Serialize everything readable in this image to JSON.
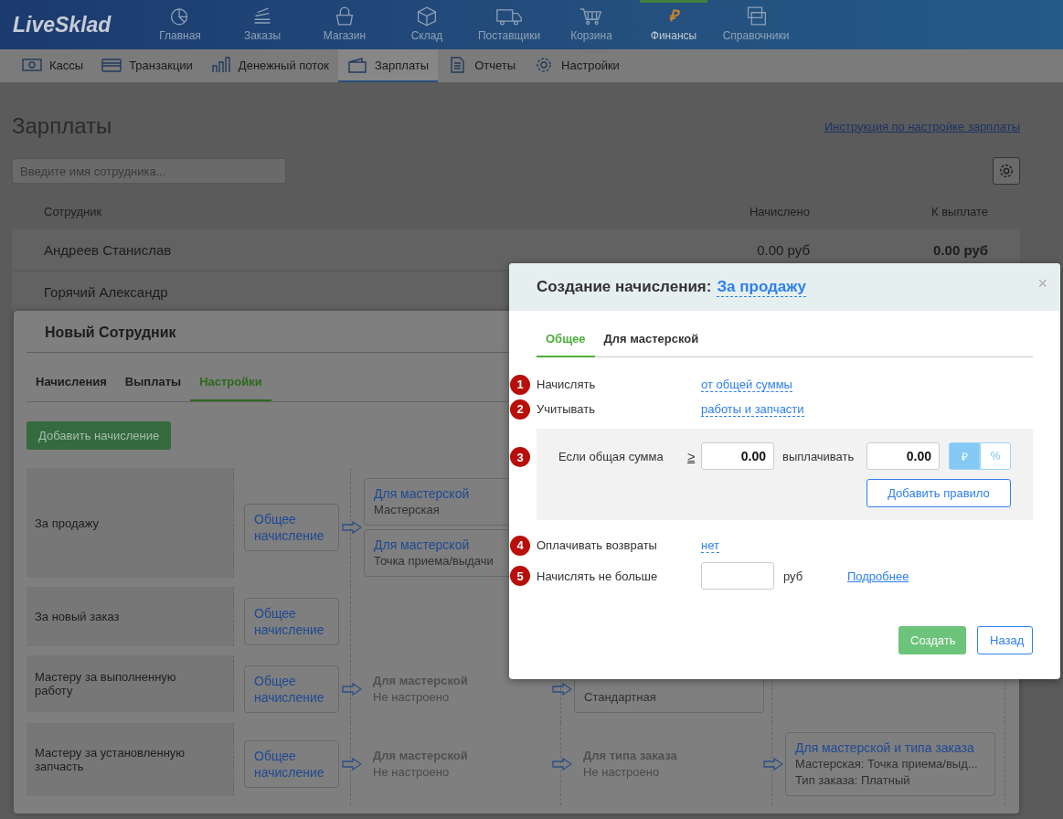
{
  "top_nav": {
    "logo": "LiveSklad",
    "items": [
      {
        "label": "Главная",
        "selected": false
      },
      {
        "label": "Заказы",
        "selected": false
      },
      {
        "label": "Магазин",
        "selected": false
      },
      {
        "label": "Склад",
        "selected": false
      },
      {
        "label": "Поставщики",
        "selected": false
      },
      {
        "label": "Корзина",
        "selected": false
      },
      {
        "label": "Финансы",
        "glyph": "₽",
        "selected": true
      },
      {
        "label": "Справочники",
        "selected": false
      }
    ]
  },
  "sub_nav": {
    "items": [
      {
        "label": "Кассы",
        "selected": false
      },
      {
        "label": "Транзакции",
        "selected": false
      },
      {
        "label": "Денежный поток",
        "selected": false
      },
      {
        "label": "Зарплаты",
        "selected": true
      },
      {
        "label": "Отчеты",
        "selected": false
      },
      {
        "label": "Настройки",
        "selected": false
      }
    ]
  },
  "page": {
    "title": "Зарплаты",
    "help_link": "Инструкция по настройке зарплаты",
    "search": {
      "placeholder": "Введите имя сотрудника..."
    },
    "table": {
      "columns": [
        "Сотрудник",
        "Начислено",
        "К выплате"
      ],
      "rows": [
        {
          "name": "Андреев Станислав",
          "accrued": "0.00 руб",
          "payable": "0.00 руб"
        },
        {
          "name": "Горячий Александр"
        }
      ]
    }
  },
  "employee_panel": {
    "title": "Новый Сотрудник",
    "tabs": [
      {
        "label": "Начисления",
        "selected": false
      },
      {
        "label": "Выплаты",
        "selected": false
      },
      {
        "label": "Настройки",
        "selected": true
      }
    ],
    "add_button": "Добавить начисление",
    "rules": [
      {
        "name": "За продажу",
        "steps": [
          [
            {
              "kind": "box",
              "title": "Общее начисление"
            }
          ],
          [
            {
              "kind": "box",
              "title": "Для мастерской",
              "lines": [
                "Мастерская"
              ]
            },
            {
              "kind": "box",
              "title": "Для мастерской",
              "lines": [
                "Точка приема/выдачи"
              ]
            }
          ]
        ]
      },
      {
        "name": "За новый заказ",
        "steps": [
          [
            {
              "kind": "box",
              "title": "Общее начисление"
            }
          ]
        ]
      },
      {
        "name": "Мастеру за выполненную работу",
        "steps": [
          [
            {
              "kind": "box",
              "title": "Общее начисление"
            }
          ],
          [
            {
              "kind": "empty",
              "title": "Для мастерской",
              "lines": [
                "Не настроено"
              ]
            }
          ],
          [
            {
              "kind": "box",
              "lines": [
                "Стандартная"
              ]
            }
          ]
        ]
      },
      {
        "name": "Мастеру за установленную запчасть",
        "steps": [
          [
            {
              "kind": "box",
              "title": "Общее начисление"
            }
          ],
          [
            {
              "kind": "empty",
              "title": "Для мастерской",
              "lines": [
                "Не настроено"
              ]
            }
          ],
          [
            {
              "kind": "empty",
              "title": "Для типа заказа",
              "lines": [
                "Не настроено"
              ]
            }
          ],
          [
            {
              "kind": "box",
              "title": "Для мастерской и типа заказа",
              "lines": [
                "Мастерская: Точка приема/выд...",
                "Тип заказа: Платный"
              ]
            }
          ]
        ]
      }
    ]
  },
  "modal": {
    "title": "Создание начисления:",
    "title_link": "За продажу",
    "close": "×",
    "tabs": [
      {
        "label": "Общее",
        "selected": true
      },
      {
        "label": "Для мастерской",
        "selected": false
      }
    ],
    "fields": [
      {
        "kind": "choice",
        "badge": "1",
        "label": "Начислять",
        "value": "от общей суммы"
      },
      {
        "kind": "choice",
        "badge": "2",
        "label": "Учитывать",
        "value": "работы и запчасти"
      },
      {
        "kind": "rules",
        "badge": "3",
        "condition": "Если общая сумма",
        "operator": "≥",
        "threshold": "0.00",
        "pay_label": "выплачивать",
        "amount": "0.00",
        "units": [
          {
            "label": "₽",
            "selected": true
          },
          {
            "label": "%",
            "selected": false
          }
        ],
        "add_button": "Добавить правило"
      },
      {
        "kind": "choice",
        "badge": "4",
        "label": "Оплачивать возвраты",
        "value": "нет"
      },
      {
        "kind": "limit",
        "badge": "5",
        "label": "Начислять не больше",
        "unit": "руб",
        "link": "Подробнее"
      }
    ],
    "buttons": [
      {
        "label": "Создать",
        "kind": "primary"
      },
      {
        "label": "Назад",
        "kind": "secondary"
      }
    ]
  }
}
